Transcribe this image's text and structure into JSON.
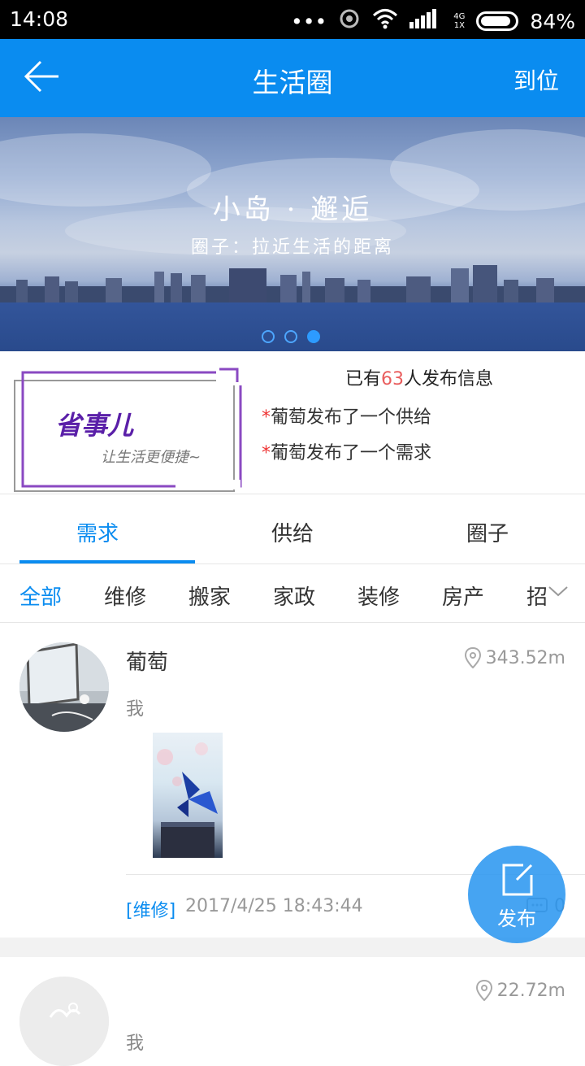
{
  "status_bar": {
    "time": "14:08",
    "network": "4G",
    "network_sub": "1X",
    "battery": "84%"
  },
  "app_bar": {
    "title": "生活圈",
    "action": "到位"
  },
  "banner": {
    "title": "小岛 · 邂逅",
    "subtitle": "圈子：拉近生活的距离",
    "page_count": 3,
    "active_page": 3
  },
  "promo": {
    "brand": "省事儿",
    "slogan": "让生活更便捷~",
    "stat_prefix": "已有",
    "stat_number": "63",
    "stat_suffix": "人发布信息",
    "lines": [
      {
        "star": "*",
        "text": "葡萄发布了一个供给"
      },
      {
        "star": "*",
        "text": "葡萄发布了一个需求"
      }
    ]
  },
  "tabs": [
    {
      "label": "需求",
      "active": true
    },
    {
      "label": "供给",
      "active": false
    },
    {
      "label": "圈子",
      "active": false
    }
  ],
  "filters": [
    "全部",
    "维修",
    "搬家",
    "家政",
    "装修",
    "房产",
    "招"
  ],
  "posts": [
    {
      "name": "葡萄",
      "distance": "343.52m",
      "content": "我",
      "tag": "[维修]",
      "time": "2017/4/25 18:43:44",
      "comments": "0"
    },
    {
      "name": "",
      "distance": "22.72m",
      "content": "我"
    }
  ],
  "fab": {
    "label": "发布"
  }
}
